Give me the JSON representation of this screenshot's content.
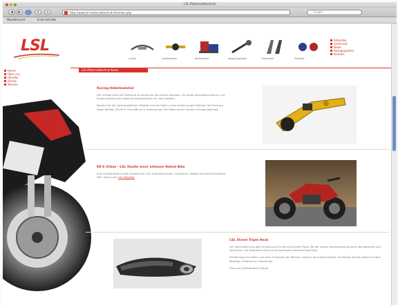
{
  "window": {
    "title": "LSL Motorradtechnik"
  },
  "toolbar": {
    "url": "http://www.lsl-motorradtechnik.de/index.php",
    "search_placeholder": "Google",
    "bookmarks": [
      "Meistbesucht",
      "Erste Schritte"
    ]
  },
  "header": {
    "logo_text": "LSL",
    "products": [
      {
        "label": "Lenker"
      },
      {
        "label": "Lenkerenden"
      },
      {
        "label": "Bremshebel"
      },
      {
        "label": "Kupplungshebel"
      },
      {
        "label": "Fussrasten"
      },
      {
        "label": "Zubehör"
      }
    ],
    "menu": [
      "Aktuelles",
      "Sortiment",
      "News",
      "Bezugsquellen",
      "Kontakt"
    ]
  },
  "sidebar": {
    "items": [
      "Home",
      "Über uns",
      "Händler",
      "Presse",
      "Messen"
    ]
  },
  "news": {
    "section_title": "LSL Motorradtechnik News",
    "articles": [
      {
        "title": "Racing-Hebelzubehör",
        "para1": "Der richtige Hebel am Motorrad ist wichtig für die sichere Kontrolle. LSL bietet verstellbare Brems- und Kupplungshebel mit sieben Einstellpositionen für viele Modelle.",
        "para2": "Passend für die unterschiedlichen Modelle sind die Hebel in drei Ausführungen lieferbar. Der Preis pro Hebel beträgt 139,90 €. Eine ABE ist in Vorbereitung. Die Hebel werden direkt in Europa gefertigt."
      },
      {
        "title": "ER-6 Urban · LSL Studie einer urbanen Naked Bike",
        "para1": "Zum Einsatz kommt unter anderem ein LSL Superbike-Lenker, Fussrasten, Spiegel und diverse Frästeile. Mehr dazu unter",
        "link": "LSL Aktuelles"
      },
      {
        "title": "LSL Street Triple Heck",
        "para1": "LSL Heckumbau-Kits gibt es jetzt auch für die neue Street Triple. Mit der kurzen Heckverkleidung wirkt das Motorrad noch sportlicher, die Anbauteile sind aus hochwertigem Kunststoff gefertigt.",
        "para2": "Die Montage ist einfach und ohne Umbauten am Rahmen möglich. Kennzeichenhalter und Blinker werden direkt am Heck befestigt. Erhältlich im Fachhandel.",
        "para3": "Preis und Lieferbarkeit in Kürze."
      }
    ]
  },
  "colors": {
    "accent": "#d8322a",
    "thumb": "#6a8fc8"
  }
}
